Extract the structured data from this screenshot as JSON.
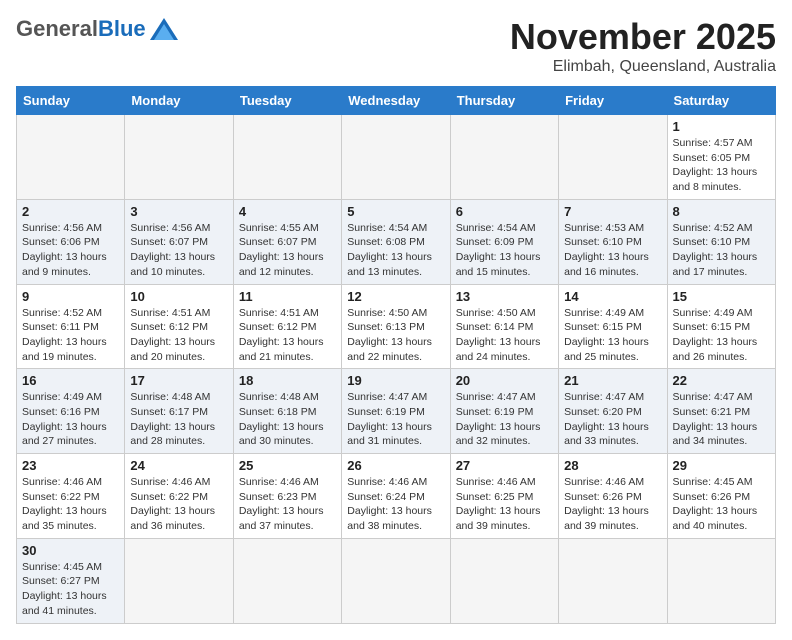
{
  "header": {
    "logo_general": "General",
    "logo_blue": "Blue",
    "month": "November 2025",
    "location": "Elimbah, Queensland, Australia"
  },
  "weekdays": [
    "Sunday",
    "Monday",
    "Tuesday",
    "Wednesday",
    "Thursday",
    "Friday",
    "Saturday"
  ],
  "weeks": [
    [
      {
        "day": "",
        "info": ""
      },
      {
        "day": "",
        "info": ""
      },
      {
        "day": "",
        "info": ""
      },
      {
        "day": "",
        "info": ""
      },
      {
        "day": "",
        "info": ""
      },
      {
        "day": "",
        "info": ""
      },
      {
        "day": "1",
        "info": "Sunrise: 4:57 AM\nSunset: 6:05 PM\nDaylight: 13 hours\nand 8 minutes."
      }
    ],
    [
      {
        "day": "2",
        "info": "Sunrise: 4:56 AM\nSunset: 6:06 PM\nDaylight: 13 hours\nand 9 minutes."
      },
      {
        "day": "3",
        "info": "Sunrise: 4:56 AM\nSunset: 6:07 PM\nDaylight: 13 hours\nand 10 minutes."
      },
      {
        "day": "4",
        "info": "Sunrise: 4:55 AM\nSunset: 6:07 PM\nDaylight: 13 hours\nand 12 minutes."
      },
      {
        "day": "5",
        "info": "Sunrise: 4:54 AM\nSunset: 6:08 PM\nDaylight: 13 hours\nand 13 minutes."
      },
      {
        "day": "6",
        "info": "Sunrise: 4:54 AM\nSunset: 6:09 PM\nDaylight: 13 hours\nand 15 minutes."
      },
      {
        "day": "7",
        "info": "Sunrise: 4:53 AM\nSunset: 6:10 PM\nDaylight: 13 hours\nand 16 minutes."
      },
      {
        "day": "8",
        "info": "Sunrise: 4:52 AM\nSunset: 6:10 PM\nDaylight: 13 hours\nand 17 minutes."
      }
    ],
    [
      {
        "day": "9",
        "info": "Sunrise: 4:52 AM\nSunset: 6:11 PM\nDaylight: 13 hours\nand 19 minutes."
      },
      {
        "day": "10",
        "info": "Sunrise: 4:51 AM\nSunset: 6:12 PM\nDaylight: 13 hours\nand 20 minutes."
      },
      {
        "day": "11",
        "info": "Sunrise: 4:51 AM\nSunset: 6:12 PM\nDaylight: 13 hours\nand 21 minutes."
      },
      {
        "day": "12",
        "info": "Sunrise: 4:50 AM\nSunset: 6:13 PM\nDaylight: 13 hours\nand 22 minutes."
      },
      {
        "day": "13",
        "info": "Sunrise: 4:50 AM\nSunset: 6:14 PM\nDaylight: 13 hours\nand 24 minutes."
      },
      {
        "day": "14",
        "info": "Sunrise: 4:49 AM\nSunset: 6:15 PM\nDaylight: 13 hours\nand 25 minutes."
      },
      {
        "day": "15",
        "info": "Sunrise: 4:49 AM\nSunset: 6:15 PM\nDaylight: 13 hours\nand 26 minutes."
      }
    ],
    [
      {
        "day": "16",
        "info": "Sunrise: 4:49 AM\nSunset: 6:16 PM\nDaylight: 13 hours\nand 27 minutes."
      },
      {
        "day": "17",
        "info": "Sunrise: 4:48 AM\nSunset: 6:17 PM\nDaylight: 13 hours\nand 28 minutes."
      },
      {
        "day": "18",
        "info": "Sunrise: 4:48 AM\nSunset: 6:18 PM\nDaylight: 13 hours\nand 30 minutes."
      },
      {
        "day": "19",
        "info": "Sunrise: 4:47 AM\nSunset: 6:19 PM\nDaylight: 13 hours\nand 31 minutes."
      },
      {
        "day": "20",
        "info": "Sunrise: 4:47 AM\nSunset: 6:19 PM\nDaylight: 13 hours\nand 32 minutes."
      },
      {
        "day": "21",
        "info": "Sunrise: 4:47 AM\nSunset: 6:20 PM\nDaylight: 13 hours\nand 33 minutes."
      },
      {
        "day": "22",
        "info": "Sunrise: 4:47 AM\nSunset: 6:21 PM\nDaylight: 13 hours\nand 34 minutes."
      }
    ],
    [
      {
        "day": "23",
        "info": "Sunrise: 4:46 AM\nSunset: 6:22 PM\nDaylight: 13 hours\nand 35 minutes."
      },
      {
        "day": "24",
        "info": "Sunrise: 4:46 AM\nSunset: 6:22 PM\nDaylight: 13 hours\nand 36 minutes."
      },
      {
        "day": "25",
        "info": "Sunrise: 4:46 AM\nSunset: 6:23 PM\nDaylight: 13 hours\nand 37 minutes."
      },
      {
        "day": "26",
        "info": "Sunrise: 4:46 AM\nSunset: 6:24 PM\nDaylight: 13 hours\nand 38 minutes."
      },
      {
        "day": "27",
        "info": "Sunrise: 4:46 AM\nSunset: 6:25 PM\nDaylight: 13 hours\nand 39 minutes."
      },
      {
        "day": "28",
        "info": "Sunrise: 4:46 AM\nSunset: 6:26 PM\nDaylight: 13 hours\nand 39 minutes."
      },
      {
        "day": "29",
        "info": "Sunrise: 4:45 AM\nSunset: 6:26 PM\nDaylight: 13 hours\nand 40 minutes."
      }
    ],
    [
      {
        "day": "30",
        "info": "Sunrise: 4:45 AM\nSunset: 6:27 PM\nDaylight: 13 hours\nand 41 minutes."
      },
      {
        "day": "",
        "info": ""
      },
      {
        "day": "",
        "info": ""
      },
      {
        "day": "",
        "info": ""
      },
      {
        "day": "",
        "info": ""
      },
      {
        "day": "",
        "info": ""
      },
      {
        "day": "",
        "info": ""
      }
    ]
  ]
}
